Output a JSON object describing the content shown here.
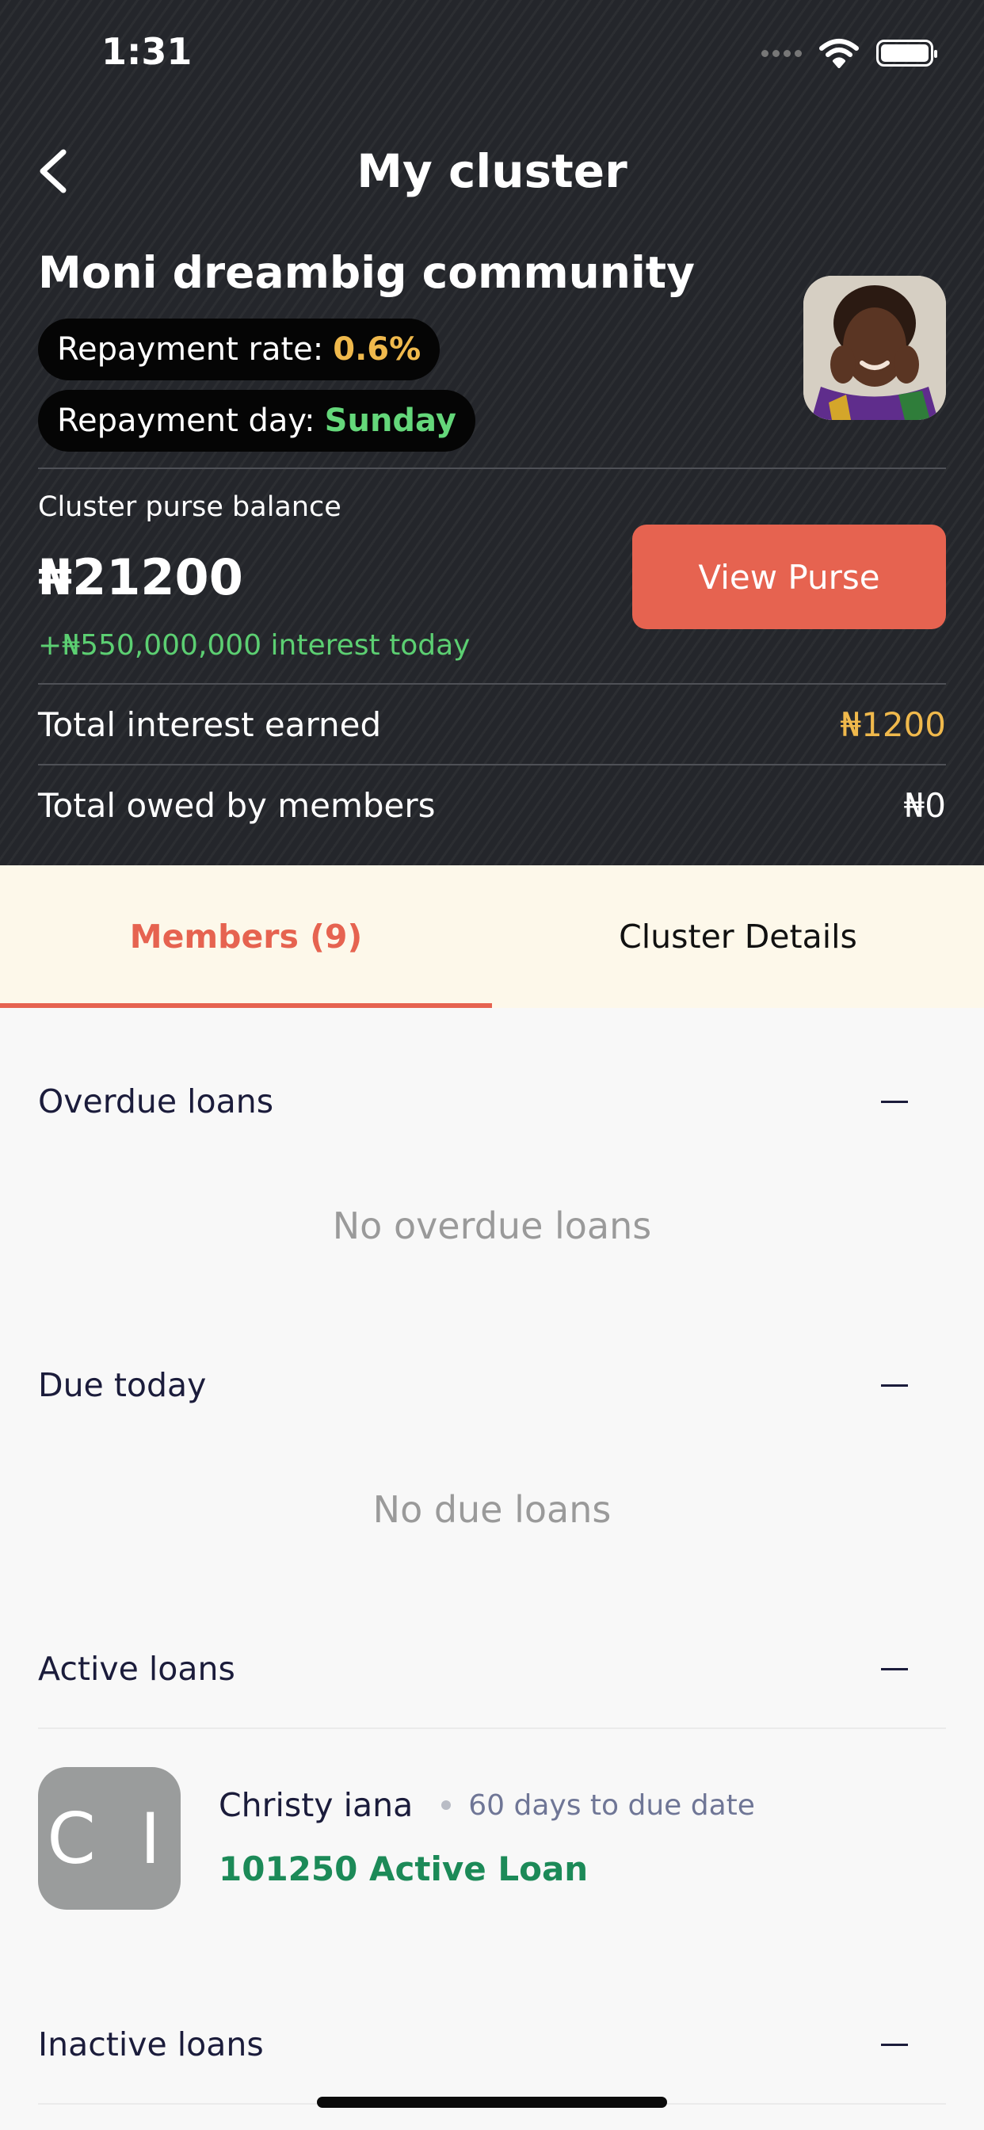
{
  "status_bar": {
    "time": "1:31"
  },
  "header": {
    "title": "My cluster",
    "community_name": "Moni dreambig community",
    "repayment_rate_label": "Repayment rate:",
    "repayment_rate_value": "0.6%",
    "repayment_day_label": "Repayment day:",
    "repayment_day_value": "Sunday",
    "purse_label": "Cluster purse balance",
    "purse_amount": "₦21200",
    "purse_interest": "+₦550,000,000 interest today",
    "view_purse_label": "View Purse",
    "total_interest_label": "Total interest earned",
    "total_interest_value": "₦1200",
    "total_owed_label": "Total owed by members",
    "total_owed_value": "₦0"
  },
  "tabs": [
    {
      "label": "Members (9)",
      "active": true
    },
    {
      "label": "Cluster Details",
      "active": false
    }
  ],
  "sections": {
    "overdue": {
      "title": "Overdue loans",
      "empty": "No overdue loans"
    },
    "due_today": {
      "title": "Due today",
      "empty": "No due loans"
    },
    "active": {
      "title": "Active loans"
    },
    "inactive": {
      "title": "Inactive loans"
    }
  },
  "active_loans": [
    {
      "initials": "C I",
      "name": "Christy iana",
      "due": "60 days to due date",
      "loan": "101250 Active Loan"
    }
  ],
  "colors": {
    "header_bg": "#24262b",
    "accent": "#e66350",
    "gold": "#f0b94c",
    "green": "#64d77a",
    "loan_green": "#1c8a58",
    "tabs_bg": "#fdf8ea"
  }
}
